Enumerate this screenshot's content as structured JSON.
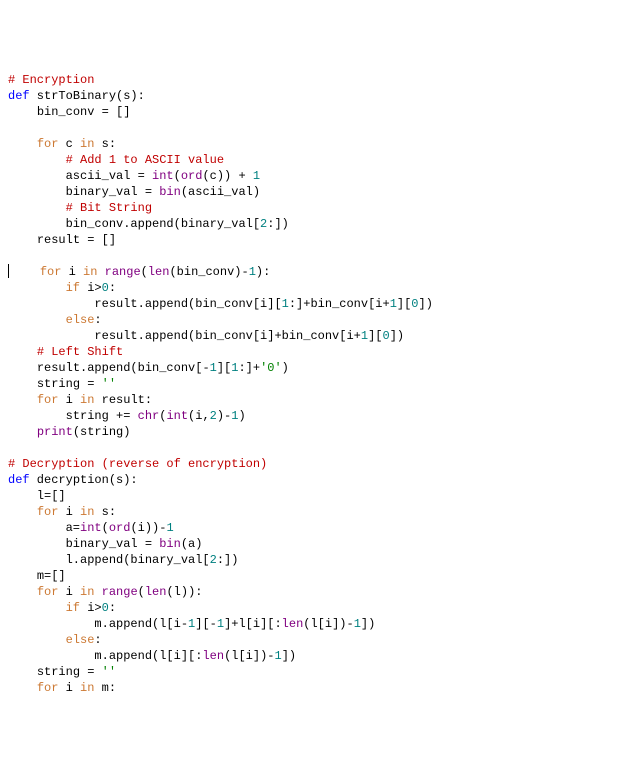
{
  "lines": [
    {
      "indent": 0,
      "cursor": false,
      "parts": [
        {
          "cls": "cm",
          "t": "# Encryption"
        }
      ]
    },
    {
      "indent": 0,
      "cursor": false,
      "parts": [
        {
          "cls": "kw",
          "t": "def"
        },
        {
          "cls": "id",
          "t": " strToBinary(s):"
        }
      ]
    },
    {
      "indent": 1,
      "cursor": false,
      "parts": [
        {
          "cls": "id",
          "t": "bin_conv = []"
        }
      ]
    },
    {
      "indent": 0,
      "cursor": false,
      "parts": []
    },
    {
      "indent": 1,
      "cursor": false,
      "parts": [
        {
          "cls": "cf",
          "t": "for"
        },
        {
          "cls": "id",
          "t": " c "
        },
        {
          "cls": "cf",
          "t": "in"
        },
        {
          "cls": "id",
          "t": " s:"
        }
      ]
    },
    {
      "indent": 2,
      "cursor": false,
      "parts": [
        {
          "cls": "cm",
          "t": "# Add 1 to ASCII value"
        }
      ]
    },
    {
      "indent": 2,
      "cursor": false,
      "parts": [
        {
          "cls": "id",
          "t": "ascii_val = "
        },
        {
          "cls": "fn",
          "t": "int"
        },
        {
          "cls": "id",
          "t": "("
        },
        {
          "cls": "fn",
          "t": "ord"
        },
        {
          "cls": "id",
          "t": "(c)) + "
        },
        {
          "cls": "num",
          "t": "1"
        }
      ]
    },
    {
      "indent": 2,
      "cursor": false,
      "parts": [
        {
          "cls": "id",
          "t": "binary_val = "
        },
        {
          "cls": "fn",
          "t": "bin"
        },
        {
          "cls": "id",
          "t": "(ascii_val)"
        }
      ]
    },
    {
      "indent": 2,
      "cursor": false,
      "parts": [
        {
          "cls": "cm",
          "t": "# Bit String"
        }
      ]
    },
    {
      "indent": 2,
      "cursor": false,
      "parts": [
        {
          "cls": "id",
          "t": "bin_conv.append(binary_val["
        },
        {
          "cls": "num",
          "t": "2"
        },
        {
          "cls": "id",
          "t": ":])"
        }
      ]
    },
    {
      "indent": 1,
      "cursor": false,
      "parts": [
        {
          "cls": "id",
          "t": "result = []"
        }
      ]
    },
    {
      "indent": 0,
      "cursor": false,
      "parts": []
    },
    {
      "indent": 1,
      "cursor": true,
      "parts": [
        {
          "cls": "cf",
          "t": "for"
        },
        {
          "cls": "id",
          "t": " i "
        },
        {
          "cls": "cf",
          "t": "in"
        },
        {
          "cls": "id",
          "t": " "
        },
        {
          "cls": "fn",
          "t": "range"
        },
        {
          "cls": "id",
          "t": "("
        },
        {
          "cls": "fn",
          "t": "len"
        },
        {
          "cls": "id",
          "t": "(bin_conv)-"
        },
        {
          "cls": "num",
          "t": "1"
        },
        {
          "cls": "id",
          "t": "):"
        }
      ]
    },
    {
      "indent": 2,
      "cursor": false,
      "parts": [
        {
          "cls": "cf",
          "t": "if"
        },
        {
          "cls": "id",
          "t": " i>"
        },
        {
          "cls": "num",
          "t": "0"
        },
        {
          "cls": "id",
          "t": ":"
        }
      ]
    },
    {
      "indent": 3,
      "cursor": false,
      "parts": [
        {
          "cls": "id",
          "t": "result.append(bin_conv[i]["
        },
        {
          "cls": "num",
          "t": "1"
        },
        {
          "cls": "id",
          "t": ":]+bin_conv[i+"
        },
        {
          "cls": "num",
          "t": "1"
        },
        {
          "cls": "id",
          "t": "]["
        },
        {
          "cls": "num",
          "t": "0"
        },
        {
          "cls": "id",
          "t": "])"
        }
      ]
    },
    {
      "indent": 2,
      "cursor": false,
      "parts": [
        {
          "cls": "cf",
          "t": "else"
        },
        {
          "cls": "id",
          "t": ":"
        }
      ]
    },
    {
      "indent": 3,
      "cursor": false,
      "parts": [
        {
          "cls": "id",
          "t": "result.append(bin_conv[i]+bin_conv[i+"
        },
        {
          "cls": "num",
          "t": "1"
        },
        {
          "cls": "id",
          "t": "]["
        },
        {
          "cls": "num",
          "t": "0"
        },
        {
          "cls": "id",
          "t": "])"
        }
      ]
    },
    {
      "indent": 1,
      "cursor": false,
      "parts": [
        {
          "cls": "cm",
          "t": "# Left Shift"
        }
      ]
    },
    {
      "indent": 1,
      "cursor": false,
      "parts": [
        {
          "cls": "id",
          "t": "result.append(bin_conv[-"
        },
        {
          "cls": "num",
          "t": "1"
        },
        {
          "cls": "id",
          "t": "]["
        },
        {
          "cls": "num",
          "t": "1"
        },
        {
          "cls": "id",
          "t": ":]+"
        },
        {
          "cls": "str",
          "t": "'0'"
        },
        {
          "cls": "id",
          "t": ")"
        }
      ]
    },
    {
      "indent": 1,
      "cursor": false,
      "parts": [
        {
          "cls": "id",
          "t": "string = "
        },
        {
          "cls": "str",
          "t": "''"
        }
      ]
    },
    {
      "indent": 1,
      "cursor": false,
      "parts": [
        {
          "cls": "cf",
          "t": "for"
        },
        {
          "cls": "id",
          "t": " i "
        },
        {
          "cls": "cf",
          "t": "in"
        },
        {
          "cls": "id",
          "t": " result:"
        }
      ]
    },
    {
      "indent": 2,
      "cursor": false,
      "parts": [
        {
          "cls": "id",
          "t": "string += "
        },
        {
          "cls": "fn",
          "t": "chr"
        },
        {
          "cls": "id",
          "t": "("
        },
        {
          "cls": "fn",
          "t": "int"
        },
        {
          "cls": "id",
          "t": "(i,"
        },
        {
          "cls": "num",
          "t": "2"
        },
        {
          "cls": "id",
          "t": ")-"
        },
        {
          "cls": "num",
          "t": "1"
        },
        {
          "cls": "id",
          "t": ")"
        }
      ]
    },
    {
      "indent": 1,
      "cursor": false,
      "parts": [
        {
          "cls": "fn",
          "t": "print"
        },
        {
          "cls": "id",
          "t": "(string)"
        }
      ]
    },
    {
      "indent": 0,
      "cursor": false,
      "parts": []
    },
    {
      "indent": 0,
      "cursor": false,
      "parts": [
        {
          "cls": "cm",
          "t": "# Decryption (reverse of encryption)"
        }
      ]
    },
    {
      "indent": 0,
      "cursor": false,
      "parts": [
        {
          "cls": "kw",
          "t": "def"
        },
        {
          "cls": "id",
          "t": " decryption(s):"
        }
      ]
    },
    {
      "indent": 1,
      "cursor": false,
      "parts": [
        {
          "cls": "id",
          "t": "l=[]"
        }
      ]
    },
    {
      "indent": 1,
      "cursor": false,
      "parts": [
        {
          "cls": "cf",
          "t": "for"
        },
        {
          "cls": "id",
          "t": " i "
        },
        {
          "cls": "cf",
          "t": "in"
        },
        {
          "cls": "id",
          "t": " s:"
        }
      ]
    },
    {
      "indent": 2,
      "cursor": false,
      "parts": [
        {
          "cls": "id",
          "t": "a="
        },
        {
          "cls": "fn",
          "t": "int"
        },
        {
          "cls": "id",
          "t": "("
        },
        {
          "cls": "fn",
          "t": "ord"
        },
        {
          "cls": "id",
          "t": "(i))-"
        },
        {
          "cls": "num",
          "t": "1"
        }
      ]
    },
    {
      "indent": 2,
      "cursor": false,
      "parts": [
        {
          "cls": "id",
          "t": "binary_val = "
        },
        {
          "cls": "fn",
          "t": "bin"
        },
        {
          "cls": "id",
          "t": "(a)"
        }
      ]
    },
    {
      "indent": 2,
      "cursor": false,
      "parts": [
        {
          "cls": "id",
          "t": "l.append(binary_val["
        },
        {
          "cls": "num",
          "t": "2"
        },
        {
          "cls": "id",
          "t": ":])"
        }
      ]
    },
    {
      "indent": 1,
      "cursor": false,
      "parts": [
        {
          "cls": "id",
          "t": "m=[]"
        }
      ]
    },
    {
      "indent": 1,
      "cursor": false,
      "parts": [
        {
          "cls": "cf",
          "t": "for"
        },
        {
          "cls": "id",
          "t": " i "
        },
        {
          "cls": "cf",
          "t": "in"
        },
        {
          "cls": "id",
          "t": " "
        },
        {
          "cls": "fn",
          "t": "range"
        },
        {
          "cls": "id",
          "t": "("
        },
        {
          "cls": "fn",
          "t": "len"
        },
        {
          "cls": "id",
          "t": "(l)):"
        }
      ]
    },
    {
      "indent": 2,
      "cursor": false,
      "parts": [
        {
          "cls": "cf",
          "t": "if"
        },
        {
          "cls": "id",
          "t": " i>"
        },
        {
          "cls": "num",
          "t": "0"
        },
        {
          "cls": "id",
          "t": ":"
        }
      ]
    },
    {
      "indent": 3,
      "cursor": false,
      "parts": [
        {
          "cls": "id",
          "t": "m.append(l[i-"
        },
        {
          "cls": "num",
          "t": "1"
        },
        {
          "cls": "id",
          "t": "][-"
        },
        {
          "cls": "num",
          "t": "1"
        },
        {
          "cls": "id",
          "t": "]+l[i][:"
        },
        {
          "cls": "fn",
          "t": "len"
        },
        {
          "cls": "id",
          "t": "(l[i])-"
        },
        {
          "cls": "num",
          "t": "1"
        },
        {
          "cls": "id",
          "t": "])"
        }
      ]
    },
    {
      "indent": 2,
      "cursor": false,
      "parts": [
        {
          "cls": "cf",
          "t": "else"
        },
        {
          "cls": "id",
          "t": ":"
        }
      ]
    },
    {
      "indent": 3,
      "cursor": false,
      "parts": [
        {
          "cls": "id",
          "t": "m.append(l[i][:"
        },
        {
          "cls": "fn",
          "t": "len"
        },
        {
          "cls": "id",
          "t": "(l[i])-"
        },
        {
          "cls": "num",
          "t": "1"
        },
        {
          "cls": "id",
          "t": "])"
        }
      ]
    },
    {
      "indent": 1,
      "cursor": false,
      "parts": [
        {
          "cls": "id",
          "t": "string = "
        },
        {
          "cls": "str",
          "t": "''"
        }
      ]
    },
    {
      "indent": 1,
      "cursor": false,
      "parts": [
        {
          "cls": "cf",
          "t": "for"
        },
        {
          "cls": "id",
          "t": " i "
        },
        {
          "cls": "cf",
          "t": "in"
        },
        {
          "cls": "id",
          "t": " m:"
        }
      ]
    }
  ],
  "indent_unit": "    "
}
